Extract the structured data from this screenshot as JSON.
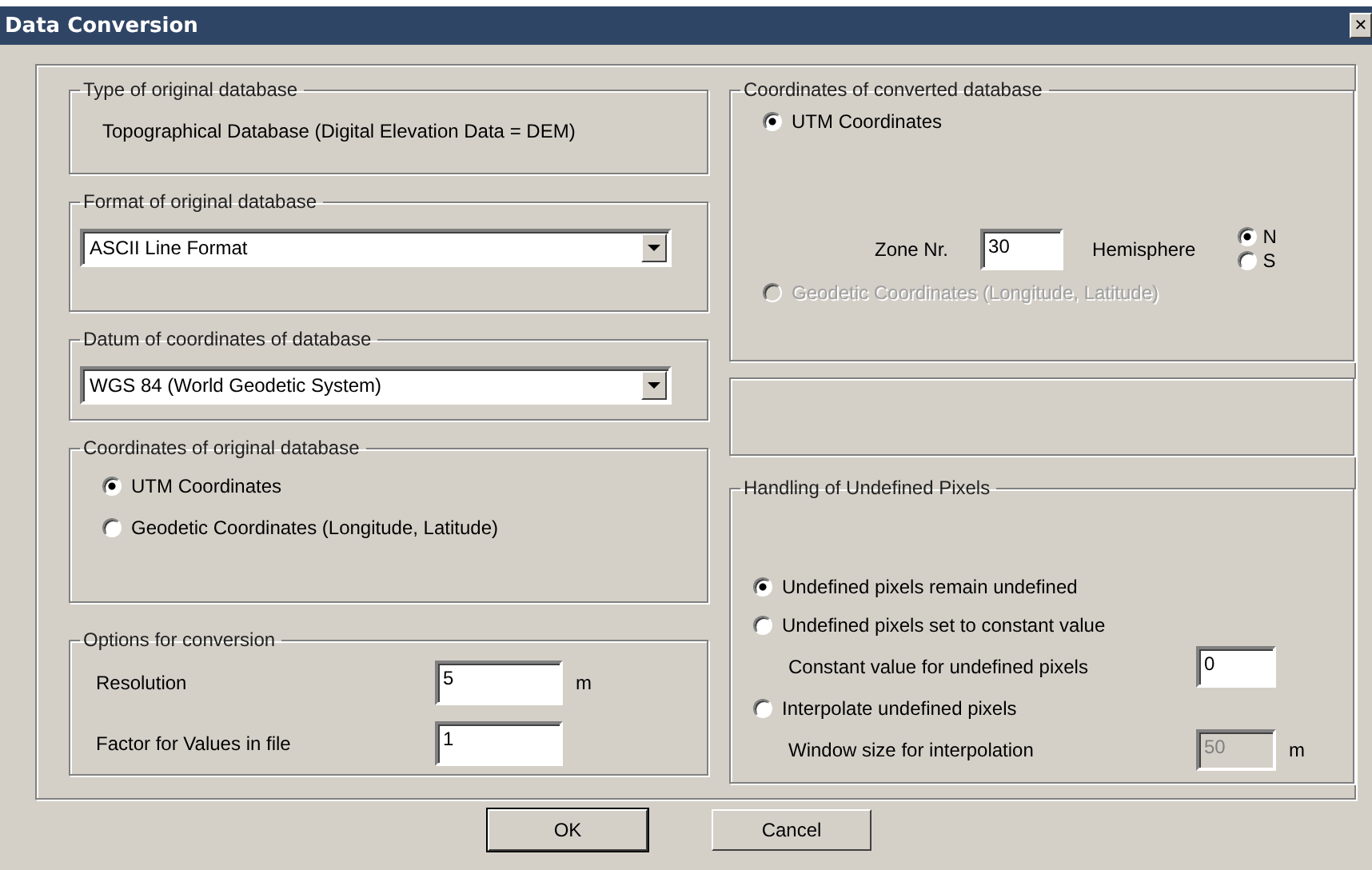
{
  "window": {
    "title": "Data Conversion",
    "close_glyph": "✕"
  },
  "type_group": {
    "title": "Type of original database",
    "text": "Topographical Database  (Digital Elevation Data = DEM)"
  },
  "format_group": {
    "title": "Format of original database",
    "value": "ASCII Line Format"
  },
  "datum_group": {
    "title": "Datum of coordinates of database",
    "value": "WGS 84 (World Geodetic System)"
  },
  "original_coords": {
    "title": "Coordinates of original database",
    "options": [
      {
        "label": "UTM Coordinates",
        "selected": true
      },
      {
        "label": "Geodetic Coordinates (Longitude, Latitude)",
        "selected": false
      }
    ]
  },
  "conversion_options": {
    "title": "Options for conversion",
    "fields": [
      {
        "label": "Resolution",
        "value": "5",
        "unit": "m"
      },
      {
        "label": "Factor for Values in file",
        "value": "1"
      }
    ]
  },
  "converted_coords": {
    "title": "Coordinates of converted database",
    "utm_option": {
      "label": "UTM Coordinates",
      "selected": true,
      "disabled": false
    },
    "zone_label": "Zone Nr.",
    "zone_value": "30",
    "hemisphere_label": "Hemisphere",
    "hemispheres": [
      {
        "label": "N",
        "selected": true
      },
      {
        "label": "S",
        "selected": false
      }
    ],
    "geodetic_option": {
      "label": "Geodetic Coordinates  (Longitude, Latitude)",
      "selected": false,
      "disabled": true
    }
  },
  "undefined_pixels": {
    "title": "Handling of Undefined Pixels",
    "options": [
      {
        "kind": "radio",
        "label": "Undefined pixels remain undefined",
        "selected": true
      },
      {
        "kind": "radio",
        "label": "Undefined pixels set to constant value",
        "selected": false
      },
      {
        "kind": "field",
        "label": "Constant value for undefined pixels",
        "value": "0",
        "disabled": false
      },
      {
        "kind": "radio",
        "label": "Interpolate undefined pixels",
        "selected": false
      },
      {
        "kind": "field",
        "label": "Window size for interpolation",
        "value": "50",
        "unit": "m",
        "disabled": true
      }
    ]
  },
  "buttons": [
    {
      "label": "OK",
      "default": true
    },
    {
      "label": "Cancel",
      "default": false
    }
  ]
}
